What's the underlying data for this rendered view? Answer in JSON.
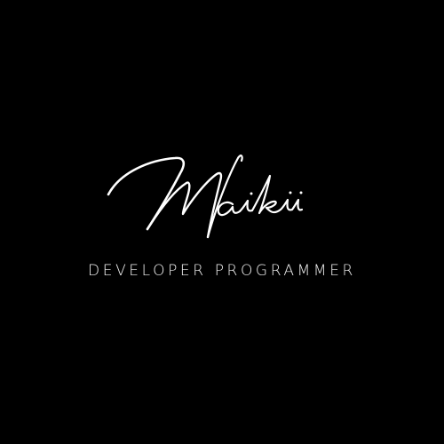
{
  "logo": {
    "script_name": "Maikii",
    "tagline": "DEVELOPER PROGRAMMER"
  },
  "colors": {
    "background": "#000000",
    "foreground": "#ffffff"
  }
}
